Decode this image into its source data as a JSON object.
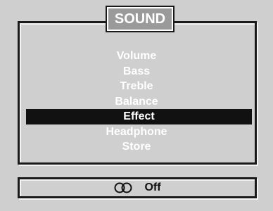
{
  "title": "SOUND",
  "menu": {
    "items": [
      {
        "label": "Volume",
        "selected": false
      },
      {
        "label": "Bass",
        "selected": false
      },
      {
        "label": "Treble",
        "selected": false
      },
      {
        "label": "Balance",
        "selected": false
      },
      {
        "label": "Effect",
        "selected": true
      },
      {
        "label": "Headphone",
        "selected": false
      },
      {
        "label": "Store",
        "selected": false
      }
    ]
  },
  "status": {
    "icon": "stereo-rings-icon",
    "value": "Off"
  },
  "colors": {
    "background": "#cfcfcf",
    "title_tab": "#9a9a9a",
    "selection": "#111111",
    "menu_text": "#ffffff"
  }
}
